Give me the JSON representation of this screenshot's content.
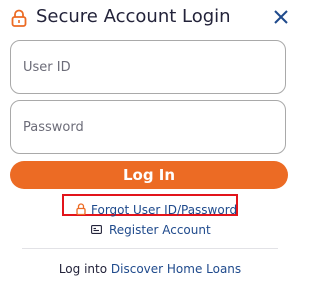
{
  "header": {
    "title": "Secure Account Login",
    "lock_icon": "lock-icon",
    "close_icon": "close-icon"
  },
  "form": {
    "user_id": {
      "placeholder": "User ID",
      "value": ""
    },
    "password": {
      "placeholder": "Password",
      "value": ""
    },
    "login_label": "Log In"
  },
  "links": {
    "forgot_label": "Forgot User ID/Password",
    "forgot_icon": "lock-icon",
    "register_label": "Register Account",
    "register_icon": "card-icon"
  },
  "footer": {
    "prefix": "Log into ",
    "link_label": "Discover Home Loans"
  },
  "colors": {
    "accent_orange": "#ec6b24",
    "link_blue": "#1f4a8c",
    "highlight_red": "#e2141b",
    "text_dark": "#23233a"
  }
}
